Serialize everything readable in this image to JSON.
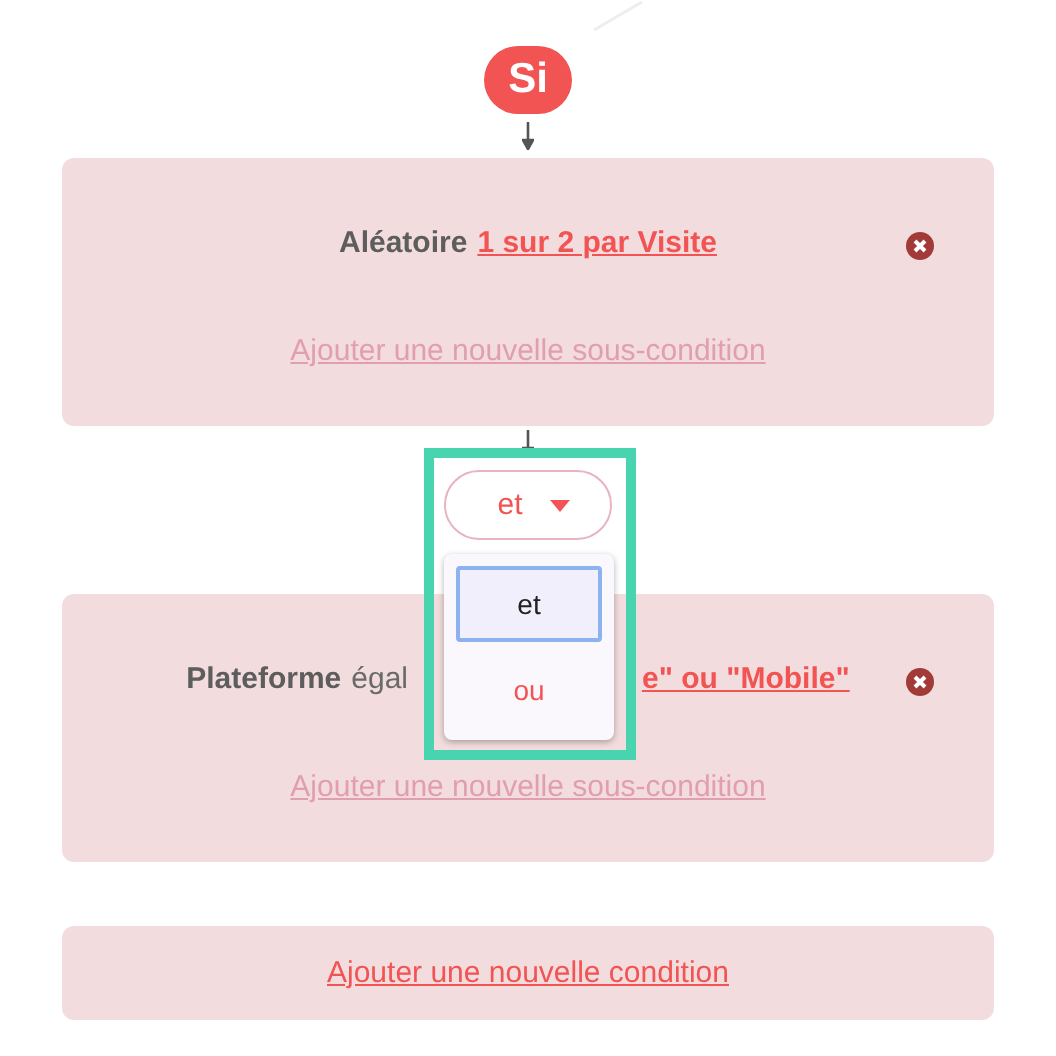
{
  "condition_badge": "Si",
  "conditions": [
    {
      "field": "Aléatoire",
      "value": "1 sur 2 par Visite",
      "add_subcondition": "Ajouter une nouvelle sous-condition"
    },
    {
      "field": "Plateforme",
      "operator": "égal",
      "value": "e\" ou \"Mobile\"",
      "add_subcondition": "Ajouter une nouvelle sous-condition"
    }
  ],
  "joiner": {
    "value": "et",
    "open": true,
    "options": [
      {
        "label": "et",
        "selected": true
      },
      {
        "label": "ou",
        "selected": false
      }
    ]
  },
  "add_condition": "Ajouter une nouvelle condition"
}
